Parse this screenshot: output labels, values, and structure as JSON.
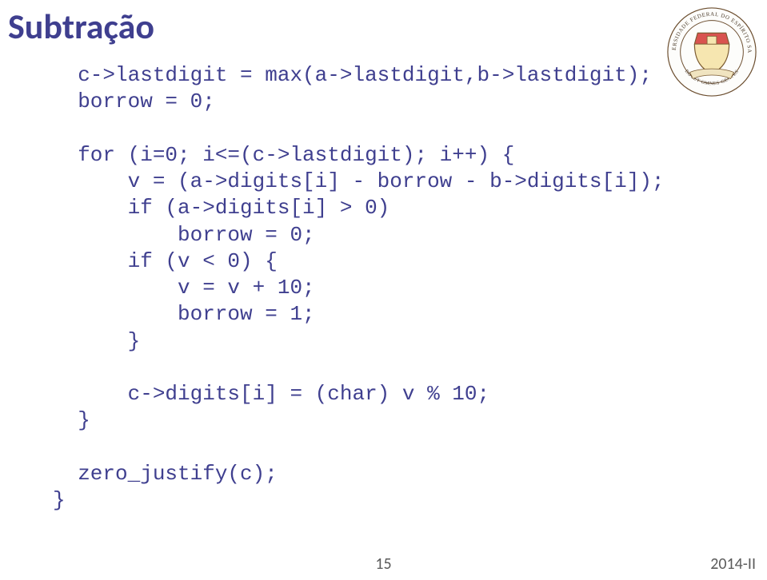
{
  "title": "Subtração",
  "code": "  c->lastdigit = max(a->lastdigit,b->lastdigit);\n  borrow = 0;\n\n  for (i=0; i<=(c->lastdigit); i++) {\n      v = (a->digits[i] - borrow - b->digits[i]);\n      if (a->digits[i] > 0)\n          borrow = 0;\n      if (v < 0) {\n          v = v + 10;\n          borrow = 1;\n      }\n\n      c->digits[i] = (char) v % 10;\n  }\n\n  zero_justify(c);\n}",
  "footer": {
    "page": "15",
    "term": "2014-II"
  },
  "seal": {
    "outer_text": "UNIVERSIDADE FEDERAL DO ESPÍRITO SANTO",
    "motto": "DOCET OMNES GENTES"
  }
}
